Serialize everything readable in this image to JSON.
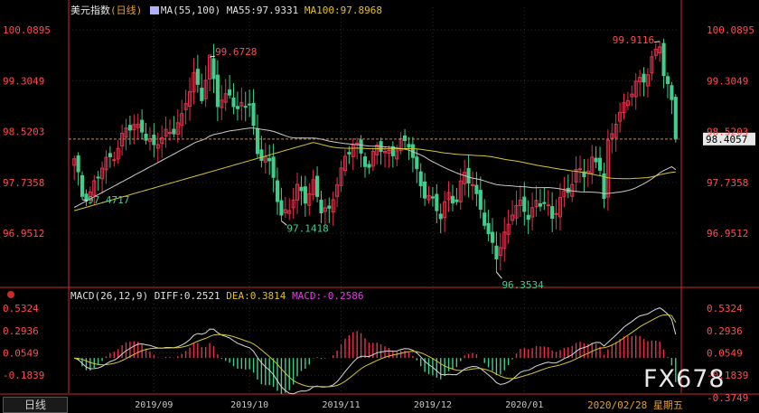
{
  "header": {
    "instrument": "美元指数",
    "period": "日线",
    "ma_label": "MA(55,100)",
    "ma55_label": "MA55:97.9331",
    "ma100_label": "MA100:97.8968"
  },
  "macd_header": {
    "label": "MACD(26,12,9)",
    "diff_label": "DIFF:0.2521",
    "dea_label": "DEA:0.3814",
    "macd_label": "MACD:-0.2586"
  },
  "price_axis": {
    "left_ticks": [
      "100.0895",
      "99.3049",
      "98.5203",
      "97.7358",
      "96.9512"
    ],
    "right_ticks": [
      "100.0895",
      "99.3049",
      "98.5203",
      "97.7358",
      "96.9512"
    ],
    "current_price": "98.4057"
  },
  "macd_axis": {
    "left_ticks": [
      "0.5324",
      "0.2936",
      "0.0549",
      "-0.1839"
    ],
    "right_ticks": [
      "0.5324",
      "0.2936",
      "0.0549",
      "-0.1839"
    ],
    "bottom_right": "-0.3749"
  },
  "annotations": {
    "high_sep": "99.6728",
    "low_aug": "97.4717",
    "low_oct": "97.1418",
    "low_dec": "96.3534",
    "high_feb": "99.9116"
  },
  "bottom_bar": {
    "period_button": "日线",
    "months": [
      "2019/09",
      "2019/10",
      "2019/11",
      "2019/12",
      "2020/01"
    ],
    "date_label": "2020/02/28 星期五"
  },
  "watermark": "FX678",
  "colors": {
    "up": "#e8304a",
    "down": "#3fcf8c",
    "ma55": "#c8c8c8",
    "ma100": "#d6c62a",
    "axis": "#cc2a2a",
    "grid": "#2b2b2b",
    "price_line": "#d08a3a",
    "text_red": "#ff4d4d"
  },
  "chart_data": {
    "type": "candlestick",
    "title": "美元指数",
    "period": "日线",
    "ylim": [
      96.2,
      100.3
    ],
    "x_months": [
      "2019/09",
      "2019/10",
      "2019/11",
      "2019/12",
      "2020/01"
    ],
    "candles": [],
    "ma55": [],
    "ma100": [],
    "macd": {
      "ylim": [
        -0.3749,
        0.62
      ],
      "diff": [],
      "dea": [],
      "hist": []
    }
  }
}
